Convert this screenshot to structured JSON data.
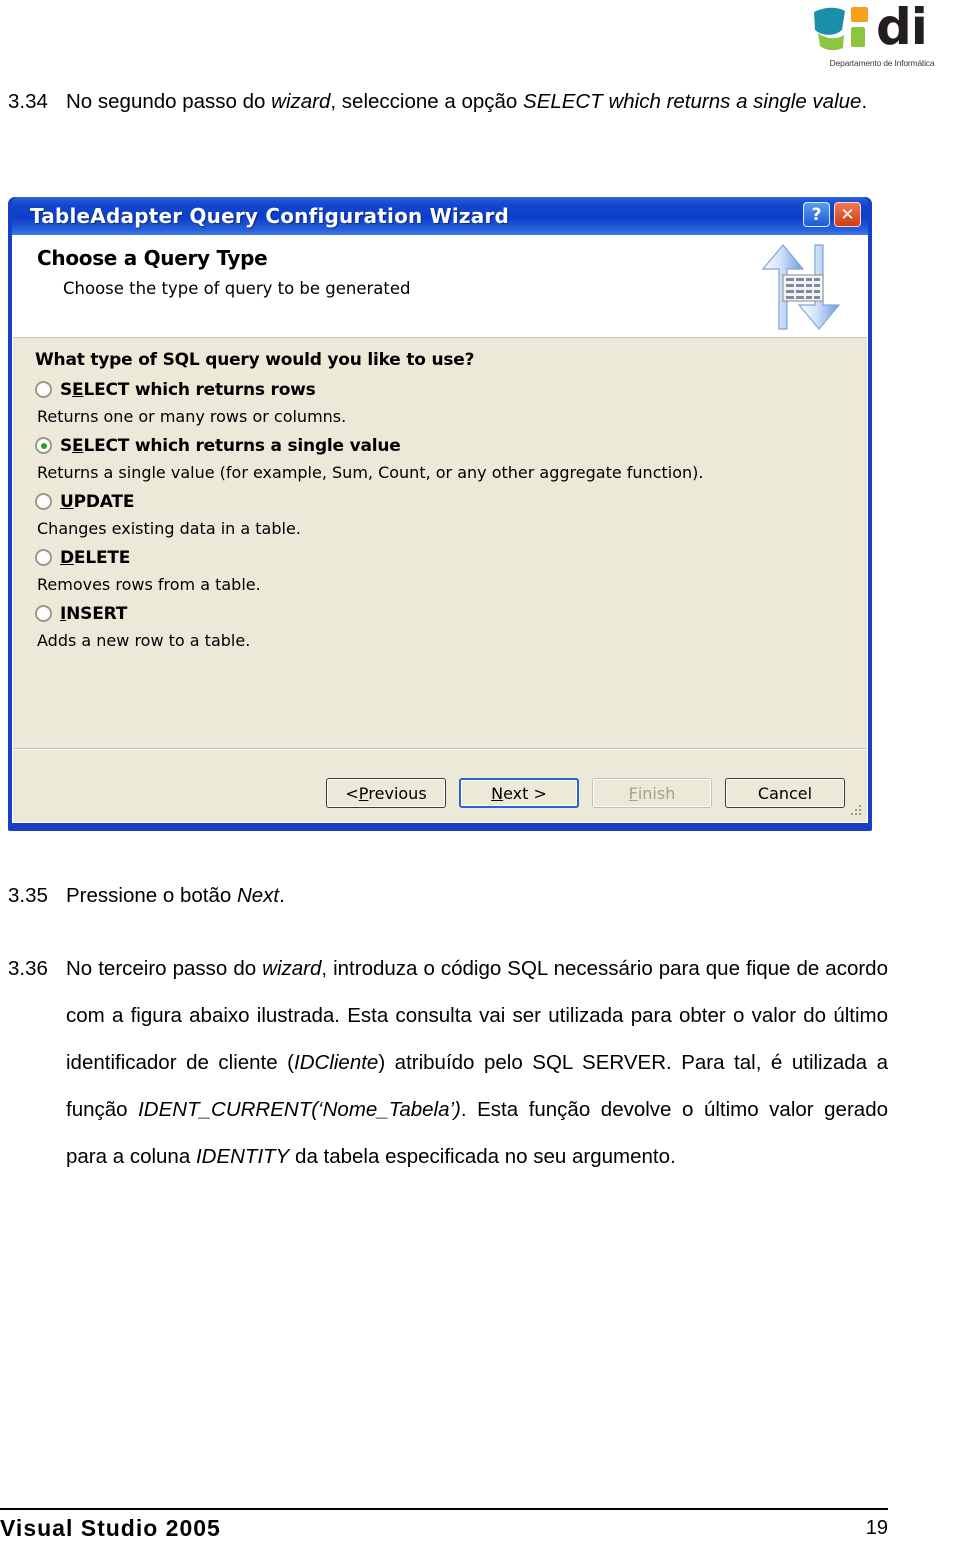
{
  "logo": {
    "wordmark": "di",
    "caption": "Departamento de Informática",
    "colors": {
      "teal": "#1b8fa8",
      "orange": "#f5a11e",
      "green": "#8cc63e",
      "dark": "#231f20"
    }
  },
  "steps": {
    "s334": {
      "number": "3.34",
      "line1_a": "No segundo passo do ",
      "line1_i": "wizard",
      "line1_b": ", seleccione a opção ",
      "line1_i2": "SELECT which returns a single value",
      "line1_c": "."
    },
    "s335": {
      "number": "3.35",
      "text_a": "Pressione o botão ",
      "text_i": "Next",
      "text_b": "."
    },
    "s336": {
      "number": "3.36",
      "t1": "No terceiro passo do ",
      "i1": "wizard",
      "t2": ", introduza o código SQL necessário para que fique de acordo com a figura abaixo ilustrada. Esta consulta vai ser utilizada para obter o valor do último identificador de cliente (",
      "i2": "IDCliente",
      "t3": ") atribuído pelo SQL SERVER. Para tal, é utilizada a função ",
      "i3": "IDENT_CURRENT(‘Nome_Tabela’)",
      "t4": ". Esta função devolve o último valor gerado para a coluna ",
      "i4": "IDENTITY",
      "t5": " da tabela especificada no seu argumento."
    }
  },
  "dialog": {
    "title": "TableAdapter Query Configuration Wizard",
    "help_button": "?",
    "close_button": "✕",
    "header": {
      "heading": "Choose a Query Type",
      "subheading": "Choose the type of query to be generated",
      "icon": "updown-arrows-table-icon"
    },
    "question": "What type of SQL query would you like to use?",
    "options": [
      {
        "label_pre": "S",
        "label_accel": "E",
        "label_post": "LECT which returns rows",
        "label_full": "SELECT which returns rows",
        "description": "Returns one or many rows or columns.",
        "selected": false
      },
      {
        "label_pre": "S",
        "label_accel": "E",
        "label_post": "LECT which returns a single value",
        "label_full": "SELECT which returns a single value",
        "description": "Returns a single value (for example, Sum, Count, or any other aggregate function).",
        "selected": true
      },
      {
        "label_pre": "",
        "label_accel": "U",
        "label_post": "PDATE",
        "label_full": "UPDATE",
        "description": "Changes existing data in a table.",
        "selected": false
      },
      {
        "label_pre": "",
        "label_accel": "D",
        "label_post": "ELETE",
        "label_full": "DELETE",
        "description": "Removes rows from a table.",
        "selected": false
      },
      {
        "label_pre": "",
        "label_accel": "I",
        "label_post": "NSERT",
        "label_full": "INSERT",
        "description": "Adds a new row to a table.",
        "selected": false
      }
    ],
    "buttons": {
      "previous": "< Previous",
      "previous_pre": "< ",
      "previous_accel": "P",
      "previous_post": "revious",
      "next": "Next >",
      "next_accel": "N",
      "next_post": "ext >",
      "finish": "Finish",
      "finish_accel": "F",
      "finish_post": "inish",
      "cancel": "Cancel"
    },
    "colors": {
      "titlebar": "#0c3fcb",
      "body": "#ece9d8",
      "header_bg": "#ffffff",
      "selected_radio": "#2aa02a",
      "default_button_border": "#2b62d6"
    }
  },
  "footer": {
    "left": "Visual Studio 2005",
    "page": "19"
  }
}
